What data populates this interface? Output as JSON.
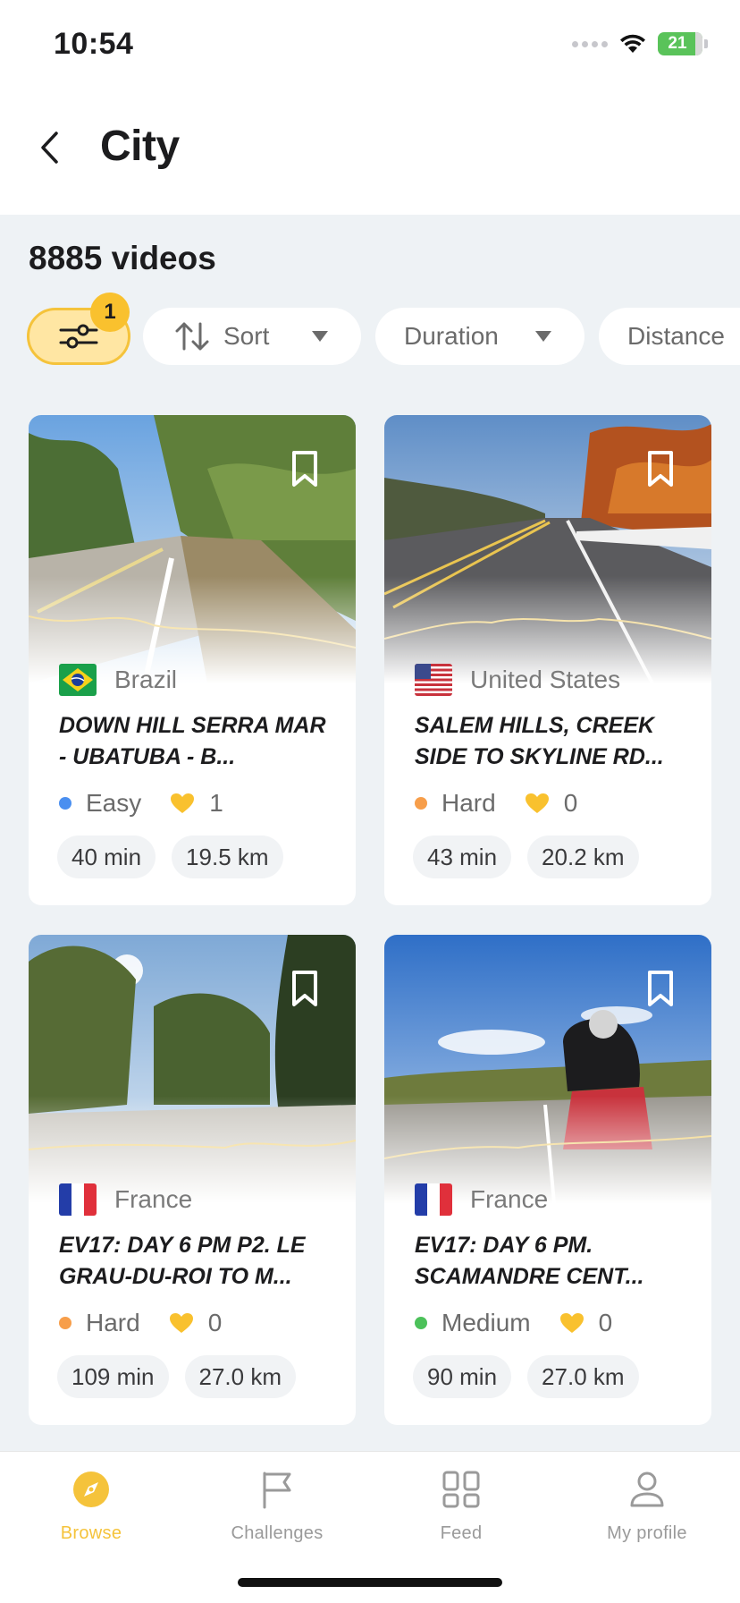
{
  "status_bar": {
    "time": "10:54",
    "battery": "21"
  },
  "header": {
    "title": "City"
  },
  "video_count": "8885 videos",
  "filters": {
    "badge_count": "1",
    "sort_label": "Sort",
    "duration_label": "Duration",
    "distance_label": "Distance"
  },
  "cards": [
    {
      "country": "Brazil",
      "title": "DOWN HILL SERRA MAR - UBATUBA - B...",
      "difficulty": "Easy",
      "difficulty_color": "#4a8ff0",
      "likes": "1",
      "duration": "40 min",
      "distance": "19.5 km"
    },
    {
      "country": "United States",
      "title": "SALEM HILLS, CREEK SIDE TO SKYLINE RD...",
      "difficulty": "Hard",
      "difficulty_color": "#f79e4a",
      "likes": "0",
      "duration": "43 min",
      "distance": "20.2 km"
    },
    {
      "country": "France",
      "title": "EV17: DAY 6 PM P2. LE GRAU-DU-ROI TO M...",
      "difficulty": "Hard",
      "difficulty_color": "#f79e4a",
      "likes": "0",
      "duration": "109 min",
      "distance": "27.0 km"
    },
    {
      "country": "France",
      "title": "EV17: DAY 6 PM. SCAMANDRE CENT...",
      "difficulty": "Medium",
      "difficulty_color": "#4cc15a",
      "likes": "0",
      "duration": "90 min",
      "distance": "27.0 km"
    }
  ],
  "tabs": [
    {
      "label": "Browse",
      "icon": "compass-icon",
      "active": true
    },
    {
      "label": "Challenges",
      "icon": "flag-icon",
      "active": false
    },
    {
      "label": "Feed",
      "icon": "grid-icon",
      "active": false
    },
    {
      "label": "My profile",
      "icon": "person-icon",
      "active": false
    }
  ],
  "colors": {
    "accent": "#f5c33b",
    "heart": "#f9c12e",
    "background": "#eef2f5"
  }
}
